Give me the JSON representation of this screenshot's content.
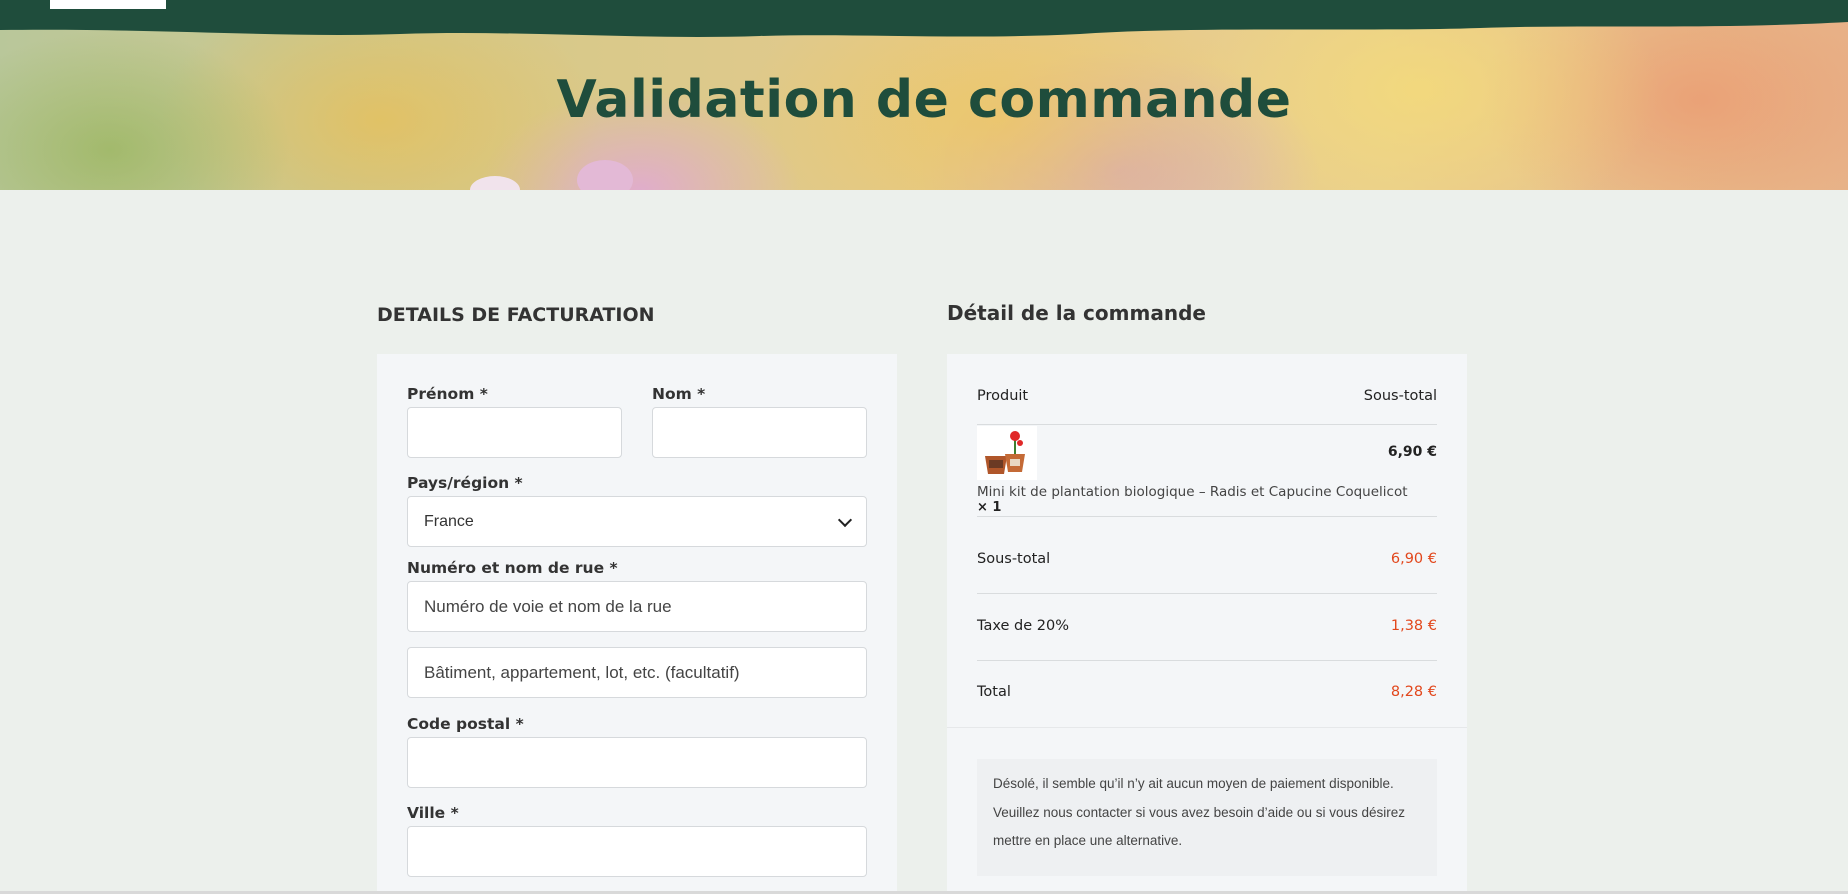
{
  "hero": {
    "title": "Validation de commande"
  },
  "billing": {
    "section_title": "DETAILS DE FACTURATION",
    "first_name_label": "Prénom *",
    "first_name_value": "",
    "last_name_label": "Nom *",
    "last_name_value": "",
    "country_label": "Pays/région *",
    "country_value": "France",
    "street_label": "Numéro et nom de rue *",
    "street_placeholder": "Numéro de voie et nom de la rue",
    "street2_placeholder": "Bâtiment, appartement, lot, etc. (facultatif)",
    "postcode_label": "Code postal *",
    "postcode_value": "",
    "city_label": "Ville *",
    "city_value": ""
  },
  "order": {
    "section_title": "Détail de la commande",
    "col_product": "Produit",
    "col_subtotal": "Sous-total",
    "item": {
      "name": "Mini kit de plantation biologique – Radis et Capucine Coquelicot",
      "quantity": "× 1",
      "price": "6,90 €",
      "icon": "product-thumbnail-icon"
    },
    "subtotal_label": "Sous-total",
    "subtotal_value": "6,90 €",
    "tax_label": "Taxe de 20%",
    "tax_value": "1,38 €",
    "total_label": "Total",
    "total_value": "8,28 €",
    "payment_notice": "Désolé, il semble qu’il n’y ait aucun moyen de paiement disponible. Veuillez nous contacter si vous avez besoin d’aide ou si vous désirez mettre en place une alternative."
  },
  "colors": {
    "brand_green": "#1f4d3c",
    "price_orange": "#e2471c",
    "page_bg": "#ecf0ec"
  }
}
